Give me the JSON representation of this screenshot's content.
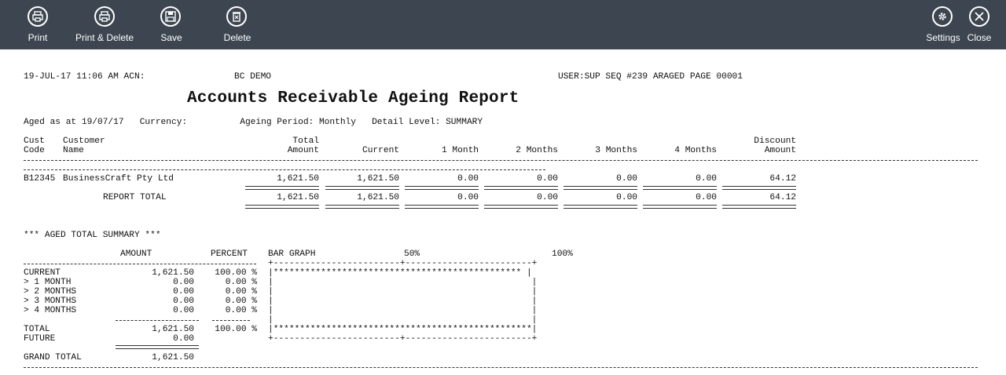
{
  "toolbar": {
    "print": "Print",
    "print_delete": "Print & Delete",
    "save": "Save",
    "delete": "Delete",
    "settings": "Settings",
    "close": "Close"
  },
  "header": {
    "left": "19-JUL-17 11:06 AM ACN:",
    "company": "BC DEMO",
    "right": "USER:SUP SEQ #239 ARAGED PAGE 00001",
    "title": "Accounts Receivable Ageing Report",
    "params": "Aged as at 19/07/17   Currency:          Ageing Period: Monthly   Detail Level: SUMMARY"
  },
  "columns": {
    "cust": [
      "Cust",
      "Code"
    ],
    "name": [
      "Customer",
      "Name"
    ],
    "total": [
      "Total",
      "Amount"
    ],
    "current": "Current",
    "m1": "1 Month",
    "m2": "2 Months",
    "m3": "3 Months",
    "m4": "4 Months",
    "discount": [
      "Discount",
      "Amount"
    ]
  },
  "rows": [
    {
      "code": "B12345",
      "name": "BusinessCraft Pty Ltd",
      "total": "1,621.50",
      "current": "1,621.50",
      "m1": "0.00",
      "m2": "0.00",
      "m3": "0.00",
      "m4": "0.00",
      "discount": "64.12"
    }
  ],
  "report_total": {
    "label": "REPORT TOTAL",
    "total": "1,621.50",
    "current": "1,621.50",
    "m1": "0.00",
    "m2": "0.00",
    "m3": "0.00",
    "m4": "0.00",
    "discount": "64.12"
  },
  "summary": {
    "heading": "*** AGED TOTAL SUMMARY ***",
    "amount_hdr": "AMOUNT",
    "percent_hdr": "PERCENT",
    "graph_hdr": "BAR GRAPH",
    "pct50": "50%",
    "pct100": "100%",
    "lines": [
      {
        "label": "CURRENT",
        "amount": "1,621.50",
        "percent": "100.00 %",
        "bar": "|*********************************************** |"
      },
      {
        "label": "> 1 MONTH",
        "amount": "0.00",
        "percent": "0.00 %",
        "bar": "|                                                 |"
      },
      {
        "label": "> 2 MONTHS",
        "amount": "0.00",
        "percent": "0.00 %",
        "bar": "|                                                 |"
      },
      {
        "label": "> 3 MONTHS",
        "amount": "0.00",
        "percent": "0.00 %",
        "bar": "|                                                 |"
      },
      {
        "label": "> 4 MONTHS",
        "amount": "0.00",
        "percent": "0.00 %",
        "bar": "|                                                 |"
      }
    ],
    "blank_bar": "|                                                 |",
    "total": {
      "label": "TOTAL",
      "amount": "1,621.50",
      "percent": "100.00 %",
      "bar": "|*************************************************|"
    },
    "future": {
      "label": "FUTURE",
      "amount": "0.00"
    },
    "grand": {
      "label": "GRAND TOTAL",
      "amount": "1,621.50"
    },
    "bar_top": "+------------------------+------------------------+",
    "bar_bottom": "+------------------------+------------------------+"
  }
}
